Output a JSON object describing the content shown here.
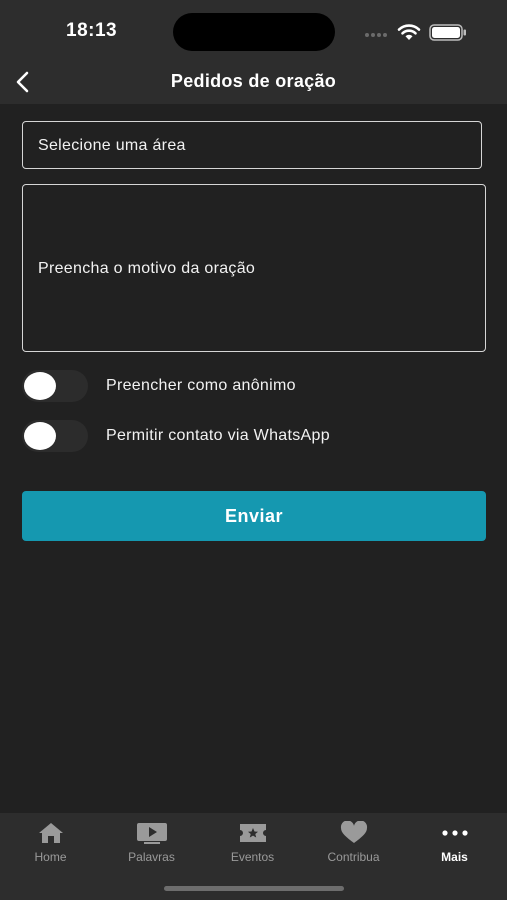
{
  "status": {
    "time": "18:13"
  },
  "header": {
    "title": "Pedidos de oração",
    "back_icon": "chevron-left-icon"
  },
  "form": {
    "area_select": {
      "value": "Selecione uma área"
    },
    "reason": {
      "placeholder": "Preencha o motivo da oração"
    },
    "toggles": [
      {
        "label": "Preencher como anônimo",
        "on": false
      },
      {
        "label": "Permitir contato via WhatsApp",
        "on": false
      }
    ],
    "submit_label": "Enviar"
  },
  "colors": {
    "accent": "#1598b0",
    "background": "#212121",
    "bar": "#2d2d2d"
  },
  "tabs": [
    {
      "label": "Home",
      "icon": "home-icon",
      "active": false
    },
    {
      "label": "Palavras",
      "icon": "video-icon",
      "active": false
    },
    {
      "label": "Eventos",
      "icon": "ticket-icon",
      "active": false
    },
    {
      "label": "Contribua",
      "icon": "heart-icon",
      "active": false
    },
    {
      "label": "Mais",
      "icon": "more-icon",
      "active": true
    }
  ]
}
